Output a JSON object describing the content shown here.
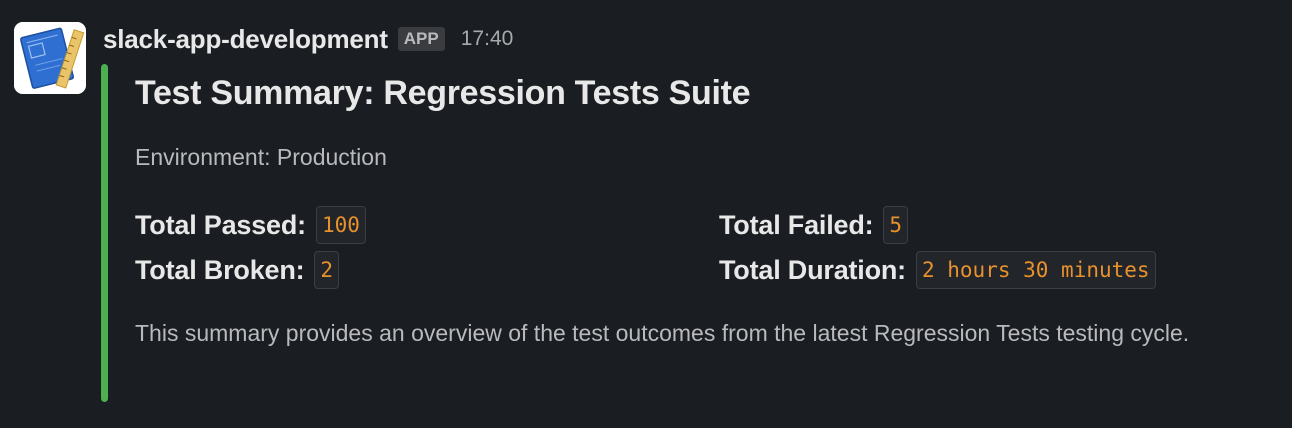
{
  "message": {
    "app_name": "slack-app-development",
    "badge": "APP",
    "timestamp": "17:40",
    "avatar_icon": "blueprint-ruler-icon"
  },
  "attachment": {
    "accent_color": "#4caf50",
    "title": "Test Summary: Regression Tests Suite",
    "environment": "Environment: Production",
    "fields": {
      "passed": {
        "label": "Total Passed:",
        "value": "100"
      },
      "failed": {
        "label": "Total Failed:",
        "value": "5"
      },
      "broken": {
        "label": "Total Broken:",
        "value": "2"
      },
      "duration": {
        "label": "Total Duration:",
        "value": "2 hours 30 minutes"
      }
    },
    "description": "This summary provides an overview of the test outcomes from the latest Regression Tests testing cycle."
  }
}
